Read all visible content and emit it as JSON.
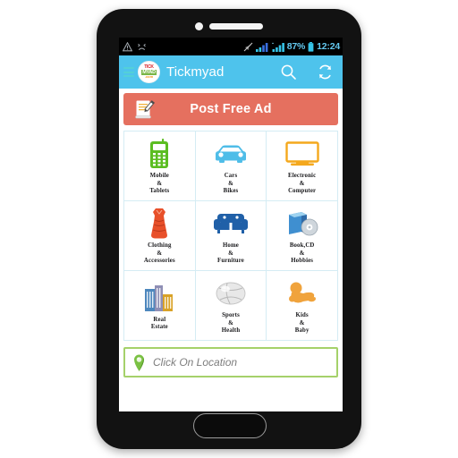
{
  "device": {
    "name": "android-phone",
    "camera_icon": "camera-dot",
    "speaker_icon": "earpiece-speaker",
    "home_button_icon": "home-button"
  },
  "status_bar": {
    "left_icons": [
      "warning-triangle-icon",
      "sad-face-icon"
    ],
    "right_icons": [
      "location-off-icon",
      "signal-bars-icon",
      "signal-bars-secondary-icon",
      "battery-icon"
    ],
    "battery_percent": "87%",
    "clock": "12:24",
    "background": "#000000",
    "text_color": "#63c8ef"
  },
  "app_bar": {
    "menu_icon": "hamburger-menu-icon",
    "logo": {
      "name": "tickmyad-logo",
      "line1": "TICK",
      "line2": "MYAD",
      "line3": ".com"
    },
    "title": "Tickmyad",
    "search_icon": "search-icon",
    "refresh_icon": "refresh-icon",
    "background": "#4ec3ec"
  },
  "post_ad": {
    "label": "Post Free Ad",
    "icon": "compose-ad-icon",
    "background": "#e5705f"
  },
  "categories": [
    {
      "name": "mobile-tablets",
      "icon": "mobile-phone-icon",
      "color": "#5bbd21",
      "lines": [
        "Mobile",
        "&",
        "Tablets"
      ]
    },
    {
      "name": "cars-bikes",
      "icon": "car-icon",
      "color": "#4fbde8",
      "lines": [
        "Cars",
        "&",
        "Bikes"
      ]
    },
    {
      "name": "electronic-computer",
      "icon": "monitor-icon",
      "color": "#f4a81d",
      "lines": [
        "Electronic",
        "&",
        "Computer"
      ]
    },
    {
      "name": "clothing-accessories",
      "icon": "dress-icon",
      "color": "#e8502a",
      "lines": [
        "Clothing",
        "&",
        "Accessories"
      ]
    },
    {
      "name": "home-furniture",
      "icon": "sofa-icon",
      "color": "#2060a8",
      "lines": [
        "Home",
        "&",
        "Furniture"
      ]
    },
    {
      "name": "book-cd-hobbies",
      "icon": "book-cd-icon",
      "color": "#2f7cc0",
      "lines": [
        "Book,CD",
        "&",
        "Hobbies"
      ]
    },
    {
      "name": "real-estate",
      "icon": "buildings-icon",
      "color": "#2f6ba8",
      "lines": [
        "Real",
        "Estate"
      ]
    },
    {
      "name": "sports-health",
      "icon": "volleyball-icon",
      "color": "#d9d9d9",
      "lines": [
        "Sports",
        "&",
        "Health"
      ]
    },
    {
      "name": "kids-baby",
      "icon": "baby-icon",
      "color": "#f0a33c",
      "lines": [
        "Kids",
        "&",
        "Baby"
      ]
    }
  ],
  "location": {
    "icon": "map-pin-icon",
    "placeholder": "Click On Location",
    "border_color": "#a5d16a"
  }
}
